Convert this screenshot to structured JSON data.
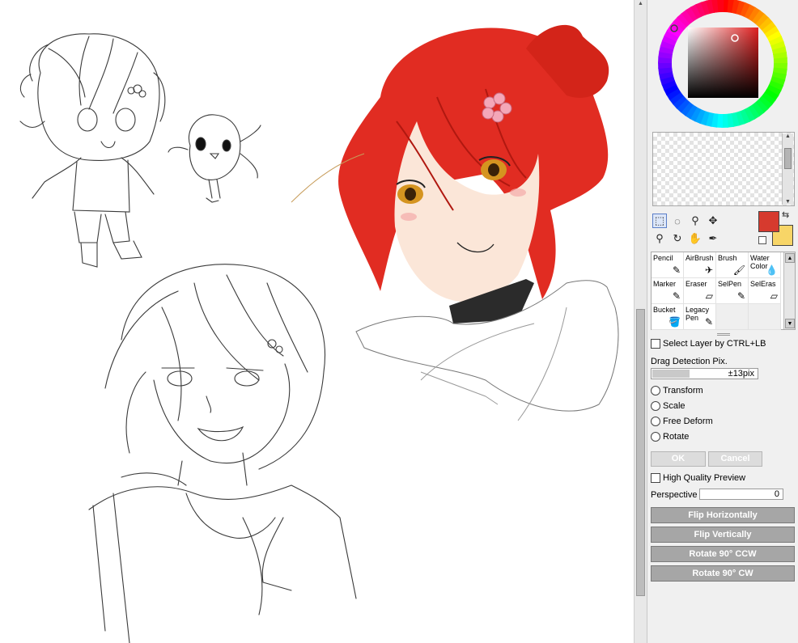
{
  "color_wheel": {
    "main_color": "#d63a2e",
    "sub_color": "#f7d567"
  },
  "tools": [
    {
      "name": "select-rect-icon",
      "glyph": "⬚"
    },
    {
      "name": "lasso-icon",
      "glyph": "◌"
    },
    {
      "name": "magic-wand-icon",
      "glyph": "⚲"
    },
    {
      "name": "move-icon",
      "glyph": "✥"
    },
    {
      "name": "zoom-icon",
      "glyph": "⚲"
    },
    {
      "name": "rotate-icon",
      "glyph": "↻"
    },
    {
      "name": "hand-icon",
      "glyph": "✋"
    },
    {
      "name": "eyedropper-icon",
      "glyph": "✒"
    }
  ],
  "brushes": [
    {
      "label": "Pencil",
      "label2": "",
      "icon": "✎"
    },
    {
      "label": "AirBrush",
      "label2": "",
      "icon": "✈"
    },
    {
      "label": "Brush",
      "label2": "",
      "icon": "🖌"
    },
    {
      "label": "Water",
      "label2": "Color",
      "icon": "💧"
    },
    {
      "label": "Marker",
      "label2": "",
      "icon": "✎"
    },
    {
      "label": "Eraser",
      "label2": "",
      "icon": "▱"
    },
    {
      "label": "SelPen",
      "label2": "",
      "icon": "✎"
    },
    {
      "label": "SelEras",
      "label2": "",
      "icon": "▱"
    },
    {
      "label": "Bucket",
      "label2": "",
      "icon": "🪣"
    },
    {
      "label": "Legacy",
      "label2": "Pen",
      "icon": "✎"
    }
  ],
  "options": {
    "select_layer_label": "Select Layer by CTRL+LB",
    "drag_detection_label": "Drag Detection Pix.",
    "drag_detection_value": "±13pix",
    "drag_detection_fill": 0.35,
    "transform_label": "Transform",
    "scale_label": "Scale",
    "free_deform_label": "Free Deform",
    "rotate_label": "Rotate",
    "ok_label": "OK",
    "cancel_label": "Cancel",
    "hq_preview_label": "High Quality Preview",
    "perspective_label": "Perspective",
    "perspective_value": "0"
  },
  "actions": {
    "flip_h": "Flip Horizontally",
    "flip_v": "Flip Vertically",
    "rot_ccw": "Rotate 90° CCW",
    "rot_cw": "Rotate 90° CW"
  }
}
